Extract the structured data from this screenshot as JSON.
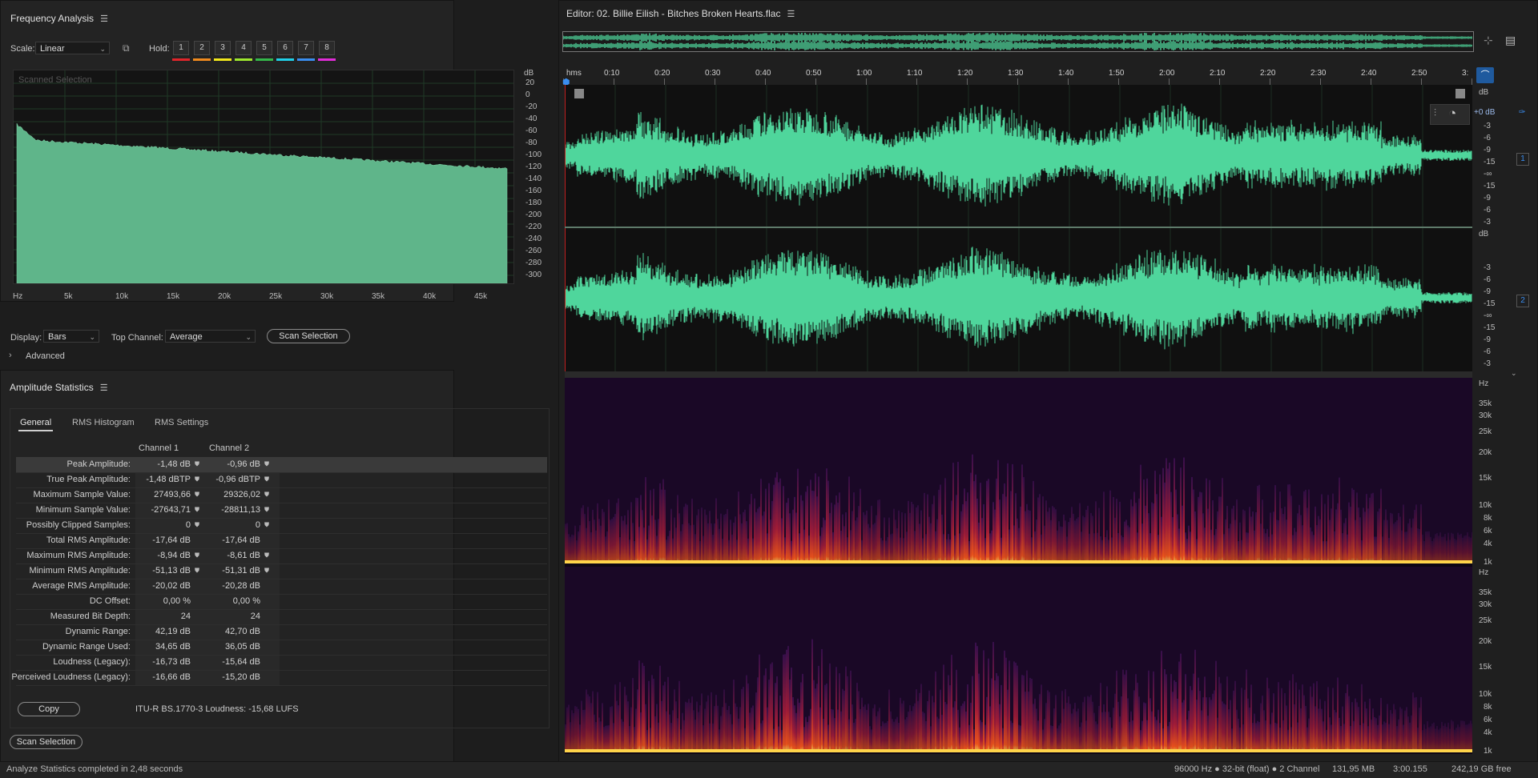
{
  "freq": {
    "title": "Frequency Analysis",
    "scale_label": "Scale:",
    "scale_value": "Linear",
    "hold_label": "Hold:",
    "hold_buttons": [
      "1",
      "2",
      "3",
      "4",
      "5",
      "6",
      "7",
      "8"
    ],
    "hold_colors": [
      "#e0252a",
      "#f08a1e",
      "#f2e81c",
      "#9ee82e",
      "#34b84a",
      "#20d0e8",
      "#3a8ef0",
      "#e02cd8"
    ],
    "graph_caption": "Scanned Selection",
    "db_unit": "dB",
    "db_ticks": [
      "20",
      "0",
      "-20",
      "-40",
      "-60",
      "-80",
      "-100",
      "-120",
      "-140",
      "-160",
      "-180",
      "-200",
      "-220",
      "-240",
      "-260",
      "-280",
      "-300"
    ],
    "hz_ticks": [
      "Hz",
      "5k",
      "10k",
      "15k",
      "20k",
      "25k",
      "30k",
      "35k",
      "40k",
      "45k"
    ],
    "display_label": "Display:",
    "display_value": "Bars",
    "top_channel_label": "Top Channel:",
    "top_channel_value": "Average",
    "scan_button": "Scan Selection",
    "advanced_label": "Advanced",
    "spectrum_color": "#5fb58a"
  },
  "amp": {
    "title": "Amplitude Statistics",
    "tabs": [
      "General",
      "RMS Histogram",
      "RMS Settings"
    ],
    "col_headers": [
      "Channel 1",
      "Channel 2"
    ],
    "rows": [
      {
        "label": "Peak Amplitude:",
        "c1": "-1,48 dB",
        "c2": "-0,96 dB",
        "pin": true
      },
      {
        "label": "True Peak Amplitude:",
        "c1": "-1,48 dBTP",
        "c2": "-0,96 dBTP",
        "pin": true
      },
      {
        "label": "Maximum Sample Value:",
        "c1": "27493,66",
        "c2": "29326,02",
        "pin": true
      },
      {
        "label": "Minimum Sample Value:",
        "c1": "-27643,71",
        "c2": "-28811,13",
        "pin": true
      },
      {
        "label": "Possibly Clipped Samples:",
        "c1": "0",
        "c2": "0",
        "pin": true
      },
      {
        "label": "Total RMS Amplitude:",
        "c1": "-17,64 dB",
        "c2": "-17,64 dB",
        "pin": false
      },
      {
        "label": "Maximum RMS Amplitude:",
        "c1": "-8,94 dB",
        "c2": "-8,61 dB",
        "pin": true
      },
      {
        "label": "Minimum RMS Amplitude:",
        "c1": "-51,13 dB",
        "c2": "-51,31 dB",
        "pin": true
      },
      {
        "label": "Average RMS Amplitude:",
        "c1": "-20,02 dB",
        "c2": "-20,28 dB",
        "pin": false
      },
      {
        "label": "DC Offset:",
        "c1": "0,00 %",
        "c2": "0,00 %",
        "pin": false
      },
      {
        "label": "Measured Bit Depth:",
        "c1": "24",
        "c2": "24",
        "pin": false
      },
      {
        "label": "Dynamic Range:",
        "c1": "42,19 dB",
        "c2": "42,70 dB",
        "pin": false
      },
      {
        "label": "Dynamic Range Used:",
        "c1": "34,65 dB",
        "c2": "36,05 dB",
        "pin": false
      },
      {
        "label": "Loudness (Legacy):",
        "c1": "-16,73 dB",
        "c2": "-15,64 dB",
        "pin": false
      },
      {
        "label": "Perceived Loudness (Legacy):",
        "c1": "-16,66 dB",
        "c2": "-15,20 dB",
        "pin": false
      }
    ],
    "copy_button": "Copy",
    "lufs_text": "ITU-R BS.1770-3 Loudness: -15,68 LUFS",
    "scan_button": "Scan Selection"
  },
  "editor": {
    "title": "Editor: 02. Billie Eilish - Bitches Broken Hearts.flac",
    "time_ticks": [
      "hms",
      "0:10",
      "0:20",
      "0:30",
      "0:40",
      "0:50",
      "1:00",
      "1:10",
      "1:20",
      "1:30",
      "1:40",
      "1:50",
      "2:00",
      "2:10",
      "2:20",
      "2:30",
      "2:40",
      "2:50",
      "3:"
    ],
    "db_unit": "dB",
    "gain_label": "+0 dB",
    "wave_db_ticks": [
      "-3",
      "-6",
      "-9",
      "-15",
      "-∞",
      "-15",
      "-9",
      "-6",
      "-3"
    ],
    "channel_labels": [
      "1",
      "2"
    ],
    "hz_unit": "Hz",
    "spec_hz_ticks": [
      "35k",
      "30k",
      "25k",
      "20k",
      "15k",
      "10k",
      "8k",
      "6k",
      "4k",
      "1k"
    ],
    "waveform_color": "#4fd69c"
  },
  "status": {
    "message": "Analyze Statistics completed in 2,48 seconds",
    "sample_info": "96000 Hz ● 32-bit (float) ● 2 Channel",
    "size": "131,95 MB",
    "duration": "3:00.155",
    "free": "242,19 GB free"
  }
}
